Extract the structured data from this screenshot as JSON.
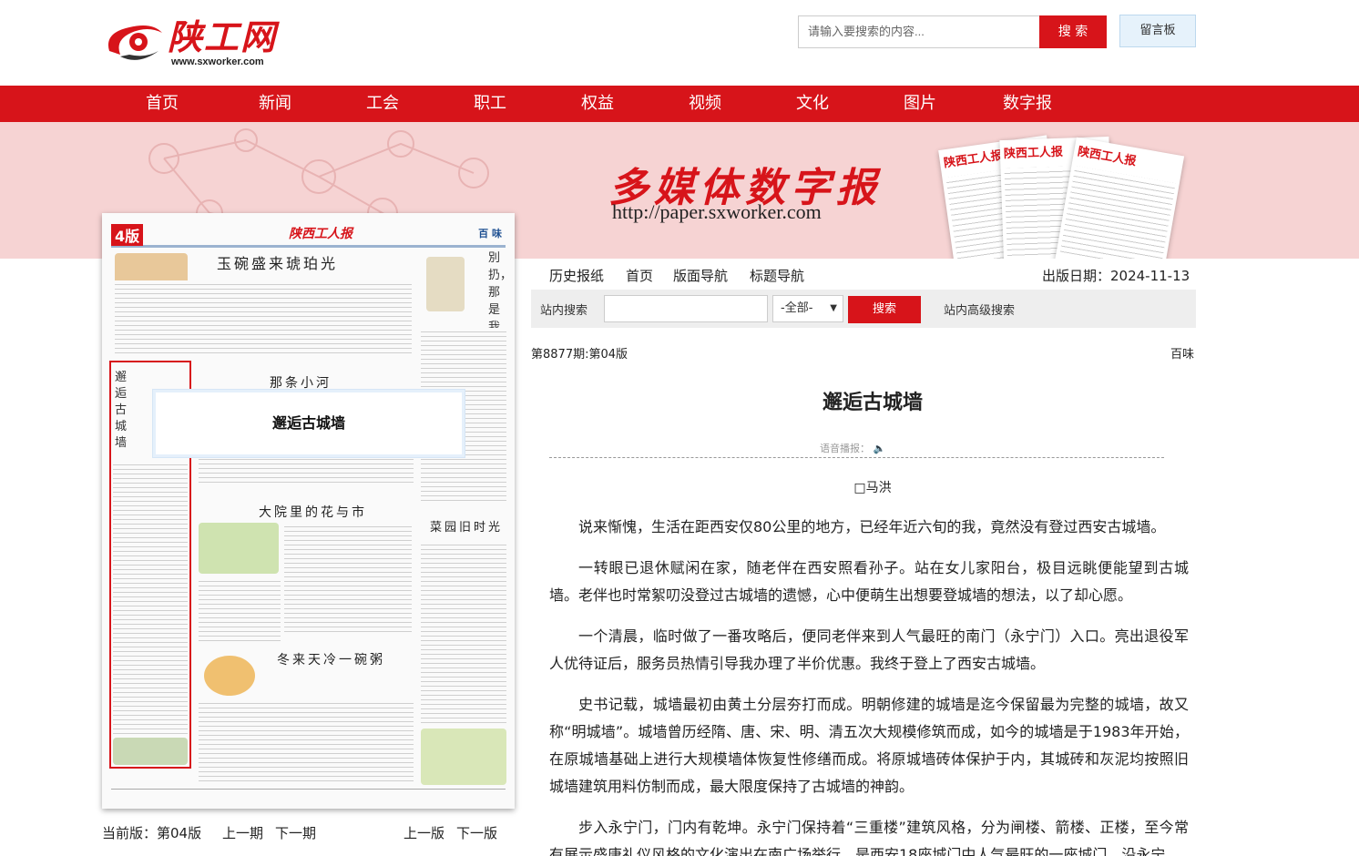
{
  "header": {
    "logo_text": "陕工网",
    "logo_url": "www.sxworker.com",
    "search_placeholder": "请输入要搜索的内容...",
    "search_button": "搜 索",
    "message_board": "留言板"
  },
  "nav": [
    "首页",
    "新闻",
    "工会",
    "职工",
    "权益",
    "视频",
    "文化",
    "图片",
    "数字报"
  ],
  "banner": {
    "title": "多媒体数字报",
    "url": "http://paper.sxworker.com",
    "paper_masthead": "陕西工人报"
  },
  "preview": {
    "page_num": "4版",
    "masthead": "陕西工人报",
    "section": "百 味",
    "headlines": [
      "玉碗盛来琥珀光",
      "那条小河",
      "大院里的花与市",
      "冬来天冷一碗粥",
      "菜园旧时光"
    ],
    "vertical_1": "別扔，那是我的书签！",
    "vertical_2": "邂逅古城墙",
    "tooltip": "邂逅古城墙"
  },
  "page_nav": {
    "current": "当前版：第04版",
    "prev_issue": "上一期",
    "next_issue": "下一期",
    "prev_page": "上一版",
    "next_page": "下一版"
  },
  "tabs": [
    "历史报纸",
    "首页",
    "版面导航",
    "标题导航"
  ],
  "pub_date": "出版日期：2024-11-13",
  "site_search": {
    "label": "站内搜索",
    "select_value": "-全部-",
    "button": "搜索",
    "advanced": "站内高级搜索"
  },
  "article": {
    "issue": "第8877期:第04版",
    "column": "百味",
    "title": "邂逅古城墙",
    "voice": "语音播报：",
    "author": "□马洪",
    "paragraphs": [
      "说来惭愧，生活在距西安仅80公里的地方，已经年近六旬的我，竟然没有登过西安古城墙。",
      "一转眼已退休赋闲在家，随老伴在西安照看孙子。站在女儿家阳台，极目远眺便能望到古城墙。老伴也时常絮叨没登过古城墙的遗憾，心中便萌生出想要登城墙的想法，以了却心愿。",
      "一个清晨，临时做了一番攻略后，便同老伴来到人气最旺的南门（永宁门）入口。亮出退役军人优待证后，服务员热情引导我办理了半价优惠。我终于登上了西安古城墙。",
      "史书记载，城墙最初由黄土分层夯打而成。明朝修建的城墙是迄今保留最为完整的城墙，故又称“明城墙”。城墙曾历经隋、唐、宋、明、清五次大规模修筑而成，如今的城墙是于1983年开始，在原城墙基础上进行大规模墙体恢复性修缮而成。将原城墙砖体保护于内，其城砖和灰泥均按照旧城墙建筑用料仿制而成，最大限度保持了古城墙的神韵。",
      "步入永宁门，门内有乾坤。永宁门保持着“三重楼”建筑风格，分为闸楼、箭楼、正楼，至今常有展示盛唐礼仪风格的文化演出在南广场举行，是西安18座城门中人气最旺的一座城门。沿永宁"
    ]
  },
  "colors": {
    "brand_red": "#d7141a",
    "banner_pink": "#f6d3d3",
    "nav_text": "#ffffff"
  }
}
